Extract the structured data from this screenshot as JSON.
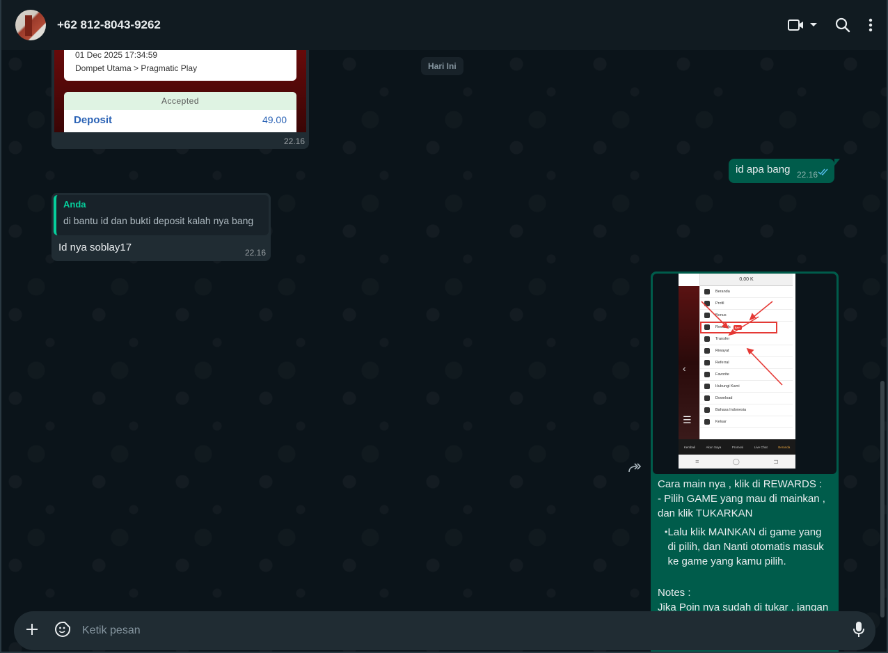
{
  "header": {
    "contact_name": "+62 812-8043-9262",
    "icons": [
      "avatar",
      "video-call-icon",
      "chevron-down-icon",
      "search-icon",
      "more-vert-icon"
    ]
  },
  "chat": {
    "date_chip": "Hari Ini",
    "messages": [
      {
        "direction": "in",
        "type": "image",
        "image": {
          "datetime": "01 Dec 2025 17:34:59",
          "wallet_from": "Dompet Utama",
          "wallet_sep": ">",
          "wallet_to": "Pragmatic Play",
          "status": "Accepted",
          "type": "Deposit",
          "amount": "49.00"
        },
        "time": "22.16"
      },
      {
        "direction": "out",
        "text": "id apa bang",
        "time": "22.16",
        "status": "read"
      },
      {
        "direction": "in",
        "quote": {
          "author": "Anda",
          "text": "di bantu id dan bukti deposit kalah nya bang"
        },
        "text": "Id nya soblay17",
        "time": "22.16"
      },
      {
        "direction": "out",
        "type": "image_caption",
        "image": {
          "balance": "0,00 K",
          "menu": [
            "Beranda",
            "Profil",
            "Bonus",
            "Rewards",
            "Transfer",
            "Riwayat",
            "Referral",
            "Favorite",
            "Hubungi Kami",
            "Download",
            "Bahasa Indonesia",
            "Keluar"
          ],
          "badge": "Baru",
          "tabs": [
            "Kembali",
            "Akun Saya",
            "Promosi",
            "Live Chat",
            "Beranda"
          ]
        },
        "caption": {
          "line1": "Cara main nya , klik di REWARDS :",
          "line2": " - Pilih  GAME yang mau di mainkan , dan klik TUKARKAN",
          "bullet": "Lalu klik MAINKAN di game yang di pilih, dan Nanti otomatis masuk ke game yang kamu pilih.",
          "notes_label": "Notes :",
          "notes_text": " Jika Poin nya sudah di tukar , jangan"
        }
      }
    ]
  },
  "composer": {
    "placeholder": "Ketik pesan",
    "icons": [
      "plus-icon",
      "sticker-icon",
      "mic-icon"
    ]
  }
}
